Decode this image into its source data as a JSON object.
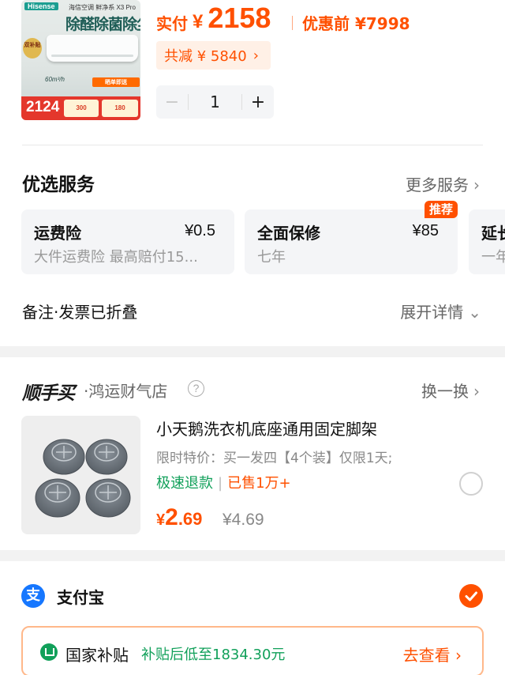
{
  "product": {
    "image": {
      "brand": "Hisense",
      "series": "海信空调 鲜净系 X3 Pro",
      "headline": "除醛除菌除尘",
      "badge": "双补贴",
      "airflow": "60m³/h",
      "price": "2124",
      "coupon_1": "300",
      "coupon_2": "180",
      "promo": "晒单即送"
    },
    "price_label": "实付",
    "currency": "¥",
    "price": "2158",
    "before_label": "优惠前",
    "before_price": "¥7998",
    "saving": "共减 ¥ 5840",
    "saving_chevron": "›",
    "quantity": "1",
    "minus": "−",
    "plus": "+"
  },
  "services": {
    "title": "优选服务",
    "more": "更多服务",
    "chevron": "›",
    "items": [
      {
        "name": "运费险",
        "fee": "¥0.5",
        "desc": "大件运费险 最高赔付15..."
      },
      {
        "name": "全面保修",
        "fee": "¥85",
        "desc": "七年",
        "badge": "推荐"
      },
      {
        "name": "延长",
        "desc": "一年"
      }
    ]
  },
  "note": {
    "label": "备注·发票已折叠",
    "expand": "展开详情",
    "chevron": "⌄"
  },
  "addon": {
    "logo": "顺手买",
    "store": "·鸿运财气店",
    "help": "?",
    "swap": "换一换",
    "chevron": "›",
    "title": "小天鹅洗衣机底座通用固定脚架",
    "desc": "限时特价：买一发四【4个装】仅限1天;",
    "tag_1": "极速退款",
    "sep": "|",
    "tag_2": "已售1万+",
    "currency": "¥",
    "price_int": "2",
    "price_dec": ".69",
    "old_price": "¥4.69"
  },
  "payment": {
    "icon": "支",
    "name": "支付宝",
    "subsidy_label": "国家补贴",
    "subsidy_info": "补贴后低至1834.30元",
    "subsidy_action": "去查看",
    "chevron": "›"
  },
  "colors": {
    "accent": "#ff5000",
    "green": "#11a05a",
    "alipay": "#1677ff"
  }
}
